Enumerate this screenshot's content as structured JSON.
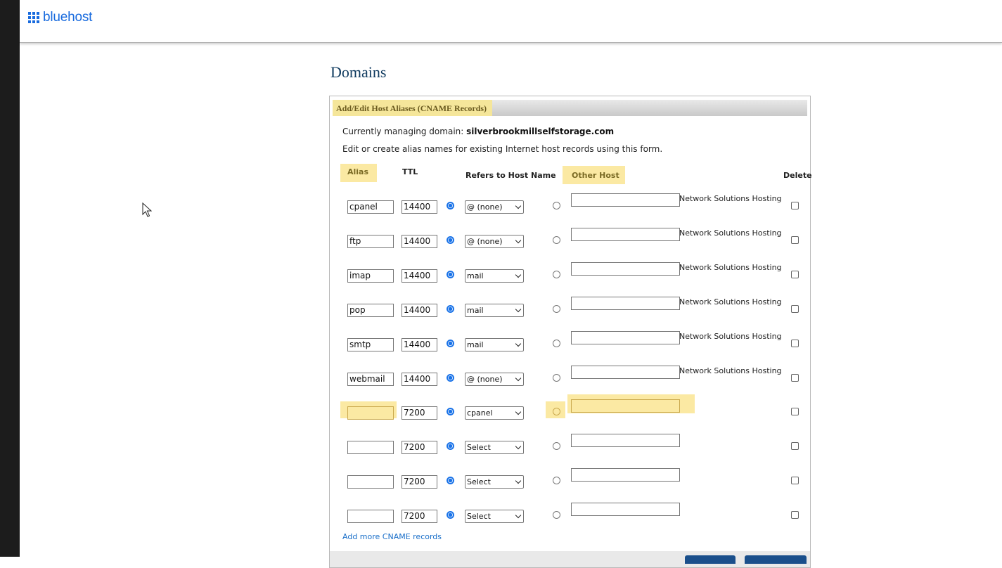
{
  "app": {
    "logo_text": "bluehost"
  },
  "page": {
    "title": "Domains"
  },
  "panel": {
    "title": "Add/Edit Host Aliases (CNAME Records)",
    "managing_label": "Currently managing domain: ",
    "managing_domain": "silverbrookmillselfstorage.com",
    "description": "Edit or create alias names for existing Internet host records using this form.",
    "columns": {
      "alias": "Alias",
      "ttl": "TTL",
      "refers": "Refers to Host Name",
      "other_host": "Other Host",
      "delete": "Delete"
    },
    "rows": [
      {
        "alias": "cpanel",
        "ttl": "14400",
        "host": "@ (none)",
        "other_host": "",
        "provider": "Network Solutions Hosting"
      },
      {
        "alias": "ftp",
        "ttl": "14400",
        "host": "@ (none)",
        "other_host": "",
        "provider": "Network Solutions Hosting"
      },
      {
        "alias": "imap",
        "ttl": "14400",
        "host": "mail",
        "other_host": "",
        "provider": "Network Solutions Hosting"
      },
      {
        "alias": "pop",
        "ttl": "14400",
        "host": "mail",
        "other_host": "",
        "provider": "Network Solutions Hosting"
      },
      {
        "alias": "smtp",
        "ttl": "14400",
        "host": "mail",
        "other_host": "",
        "provider": "Network Solutions Hosting"
      },
      {
        "alias": "webmail",
        "ttl": "14400",
        "host": "@ (none)",
        "other_host": "",
        "provider": "Network Solutions Hosting"
      },
      {
        "alias": "",
        "ttl": "7200",
        "host": "cpanel",
        "other_host": "",
        "provider": ""
      },
      {
        "alias": "",
        "ttl": "7200",
        "host": "Select",
        "other_host": "",
        "provider": ""
      },
      {
        "alias": "",
        "ttl": "7200",
        "host": "Select",
        "other_host": "",
        "provider": ""
      },
      {
        "alias": "",
        "ttl": "7200",
        "host": "Select",
        "other_host": "",
        "provider": ""
      }
    ],
    "add_more_link": "Add more CNAME records"
  },
  "colors": {
    "brand": "#196bde",
    "title": "#0f3a5f",
    "highlight": "#fbe9a3",
    "radio_selected": "#1a73e8",
    "link": "#1a6fc9"
  },
  "icons": {
    "logo": "grid-icon",
    "cursor": "mouse-pointer-icon",
    "select": "chevron-down-icon"
  }
}
